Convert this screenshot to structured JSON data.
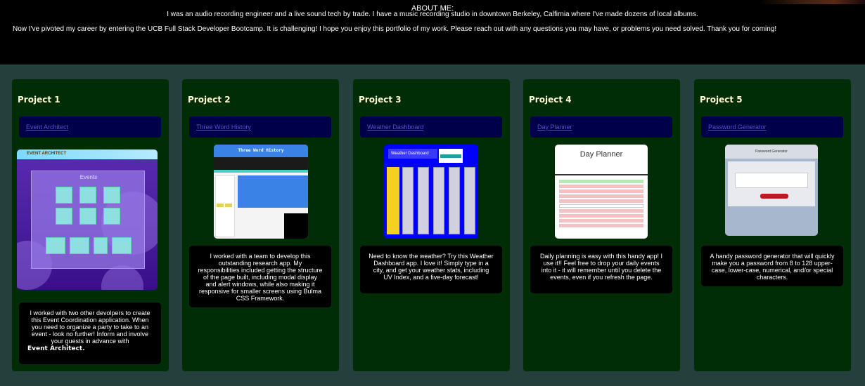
{
  "about": {
    "heading": "ABOUT ME:",
    "paragraph1": "I was an audio recording engineer and a live sound tech by trade. I have a music recording studio in downtown Berkeley, Calfirnia where I've made dozens of local albums.",
    "paragraph2": "Now I've pivoted my career by entering the UCB Full Stack Developer Bootcamp. It is challenging! I hope you enjoy this portfolio of my work. Please reach out with any questions you may have, or problems you need solved. Thank you for coming!"
  },
  "projects": [
    {
      "title": "Project 1",
      "link": "Event Architect",
      "thumbnail": "event-architect-screenshot",
      "thumb_heading": "Events",
      "thumb_logo": "EVENT ARCHITECT",
      "description": "I worked with two other devolpers to create this Event Coordination application. When you need to organize a party to take to an event - look no further! Inform and involve your guests in advance with",
      "description_extra": "Event Architect."
    },
    {
      "title": "Project 2",
      "link": "Three Word History",
      "thumbnail": "three-word-history-screenshot",
      "thumb_heading": "Three Word History",
      "description": "I worked with a team to develop this outstanding research app. My responsibilities included getting the structure of the page built, including modal display and alert windows, while also making it responsive for smaller screens using Bulma CSS Framework."
    },
    {
      "title": "Project 3",
      "link": "Weather Dashboard",
      "thumbnail": "weather-dashboard-screenshot",
      "thumb_heading": "Weather Dashboard",
      "description": "Need to know the weather? Try this Weather Dashboard app. I love it! Simply type in a city, and get your weather stats, including UV Index, and a five-day forecast!"
    },
    {
      "title": "Project 4",
      "link": "Day Planner",
      "thumbnail": "day-planner-screenshot",
      "thumb_heading": "Day Planner",
      "description": "Daily planning is easy with this handy app! I use it!! Feel free to drop your daily events into it - it will remember until you delete the events, even if you refresh the page."
    },
    {
      "title": "Project 5",
      "link": "Password Generator",
      "thumbnail": "password-generator-screenshot",
      "thumb_heading": "Password Generator",
      "description": "A handy password generator that will quickly make you a password from 8 to 128 upper-case, lower-case, numerical, and/or special characters."
    }
  ],
  "colors": {
    "page_background": "#000000",
    "section_background": "#24403c",
    "card_background": "#002d05",
    "title_color": "#fff8d0",
    "link_box": "#00004a",
    "link_color": "#5a4ad2"
  }
}
